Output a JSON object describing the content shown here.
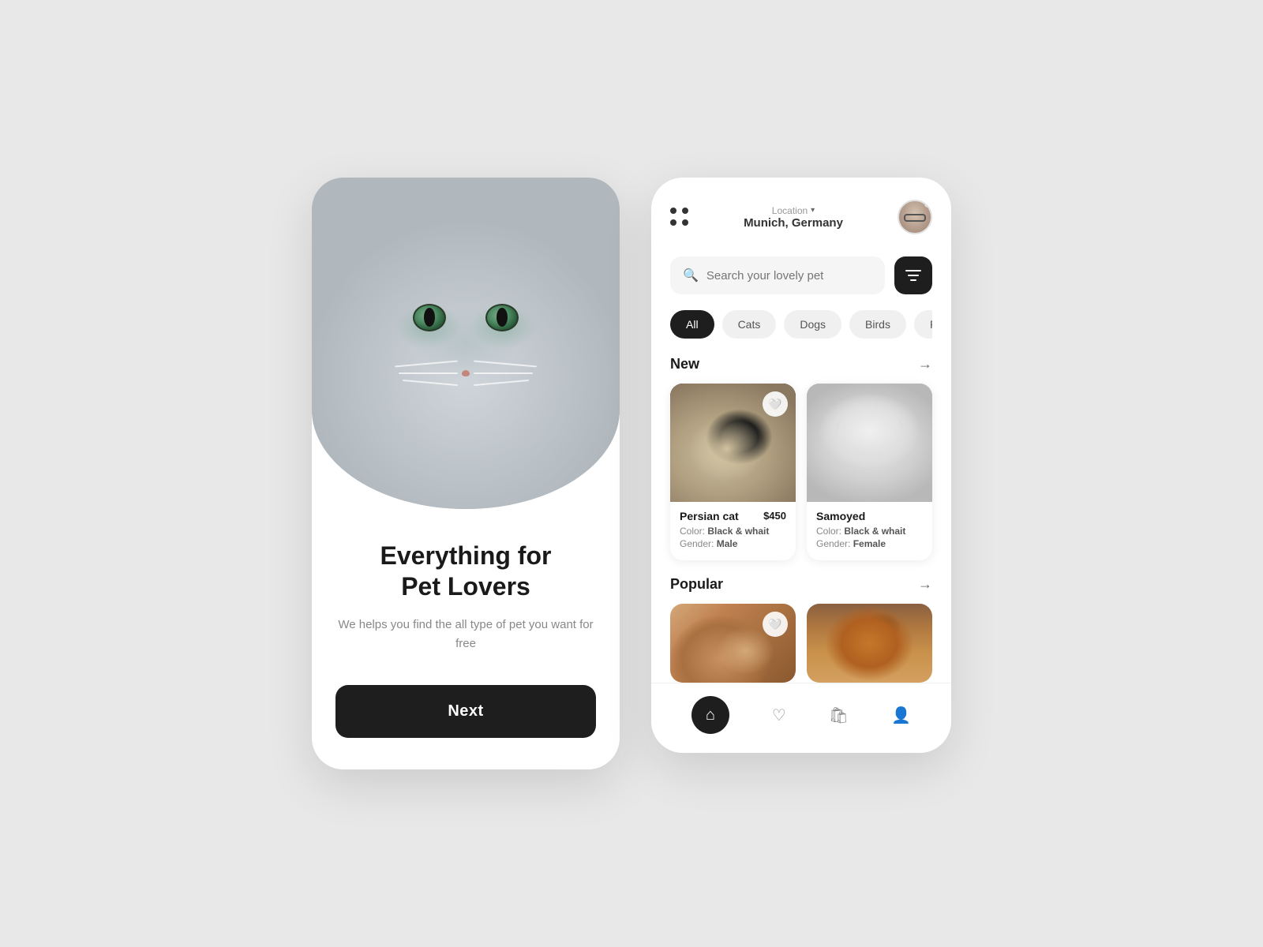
{
  "background_color": "#e8e8e8",
  "left_screen": {
    "title_line1": "Everything for",
    "title_line2": "Pet Lovers",
    "subtitle": "We helps you find the all type of pet you want for free",
    "next_button_label": "Next"
  },
  "right_screen": {
    "header": {
      "menu_aria": "dots menu",
      "location_label": "Location",
      "city": "Munich, ",
      "city_bold": "Germany"
    },
    "search": {
      "placeholder": "Search your lovely pet"
    },
    "filter_button_aria": "filter",
    "categories": [
      {
        "label": "All",
        "active": true
      },
      {
        "label": "Cats",
        "active": false
      },
      {
        "label": "Dogs",
        "active": false
      },
      {
        "label": "Birds",
        "active": false
      },
      {
        "label": "Rab",
        "active": false
      }
    ],
    "new_section": {
      "title": "New",
      "pets": [
        {
          "name": "Persian cat",
          "price": "$450",
          "color": "Black & whait",
          "gender": "Male",
          "has_heart": true
        },
        {
          "name": "Samoyed",
          "price": "",
          "color": "Black & whait",
          "gender": "Female",
          "has_heart": false
        }
      ]
    },
    "popular_section": {
      "title": "Popular",
      "pets": [
        {
          "has_heart": true
        },
        {
          "has_heart": false
        }
      ]
    },
    "nav": {
      "items": [
        {
          "icon": "home",
          "active": true
        },
        {
          "icon": "heart",
          "active": false
        },
        {
          "icon": "bag",
          "active": false
        },
        {
          "icon": "person",
          "active": false
        }
      ]
    }
  }
}
